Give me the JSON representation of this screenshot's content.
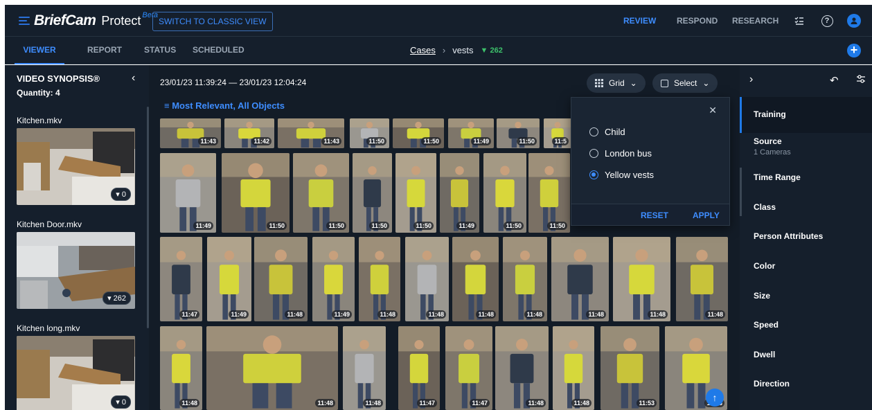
{
  "app": {
    "brand": "BriefCam",
    "product": "Protect",
    "beta": "Beta",
    "classic_button": "SWITCH TO CLASSIC VIEW",
    "nav": [
      "REVIEW",
      "RESPOND",
      "RESEARCH"
    ],
    "active_nav": "REVIEW",
    "accent_color": "#3e8dff"
  },
  "subnav": {
    "tabs": [
      "VIEWER",
      "REPORT",
      "STATUS",
      "SCHEDULED"
    ],
    "active_tab": "VIEWER",
    "breadcrumb": {
      "root": "Cases",
      "current": "vests",
      "count": "262"
    }
  },
  "sidebar": {
    "title": "VIDEO SYNOPSIS®",
    "quantity": "Quantity: 4",
    "videos": [
      {
        "name": "Kitchen.mkv",
        "count": "0"
      },
      {
        "name": "Kitchen Door.mkv",
        "count": "262"
      },
      {
        "name": "Kitchen long.mkv",
        "count": "0"
      }
    ]
  },
  "main": {
    "date_range": "23/01/23 11:39:24 — 23/01/23 12:04:24",
    "sort_label": "Most Relevant, All Objects",
    "view_button": "Grid",
    "select_button": "Select",
    "row1_times": [
      "11:43",
      "11:42",
      "11:43",
      "11:50",
      "11:50",
      "11:49",
      "11:50",
      "11:5"
    ],
    "row2_times": [
      "11:49",
      "11:50",
      "11:50",
      "11:50",
      "11:50",
      "11:49",
      "11:50",
      "11:50"
    ],
    "row3_times": [
      "11:47",
      "11:49",
      "11:48",
      "11:49",
      "11:48",
      "11:48",
      "11:48",
      "11:48",
      "11:48",
      "11:48",
      "11:48"
    ],
    "row4_times": [
      "11:48",
      "11:48",
      "11:48",
      "11:47",
      "11:47",
      "11:48",
      "11:48",
      "11:53",
      "11:53"
    ]
  },
  "class_popup": {
    "options": [
      "Child",
      "London bus",
      "Yellow vests"
    ],
    "selected": "Yellow vests",
    "reset": "RESET",
    "apply": "APPLY"
  },
  "filters": {
    "items": [
      {
        "label": "Training",
        "sub": ""
      },
      {
        "label": "Source",
        "sub": "1 Cameras"
      },
      {
        "label": "Time Range",
        "sub": ""
      },
      {
        "label": "Class",
        "sub": ""
      },
      {
        "label": "Person Attributes",
        "sub": ""
      },
      {
        "label": "Color",
        "sub": ""
      },
      {
        "label": "Size",
        "sub": ""
      },
      {
        "label": "Speed",
        "sub": ""
      },
      {
        "label": "Dwell",
        "sub": ""
      },
      {
        "label": "Direction",
        "sub": ""
      }
    ],
    "active": "Training"
  }
}
